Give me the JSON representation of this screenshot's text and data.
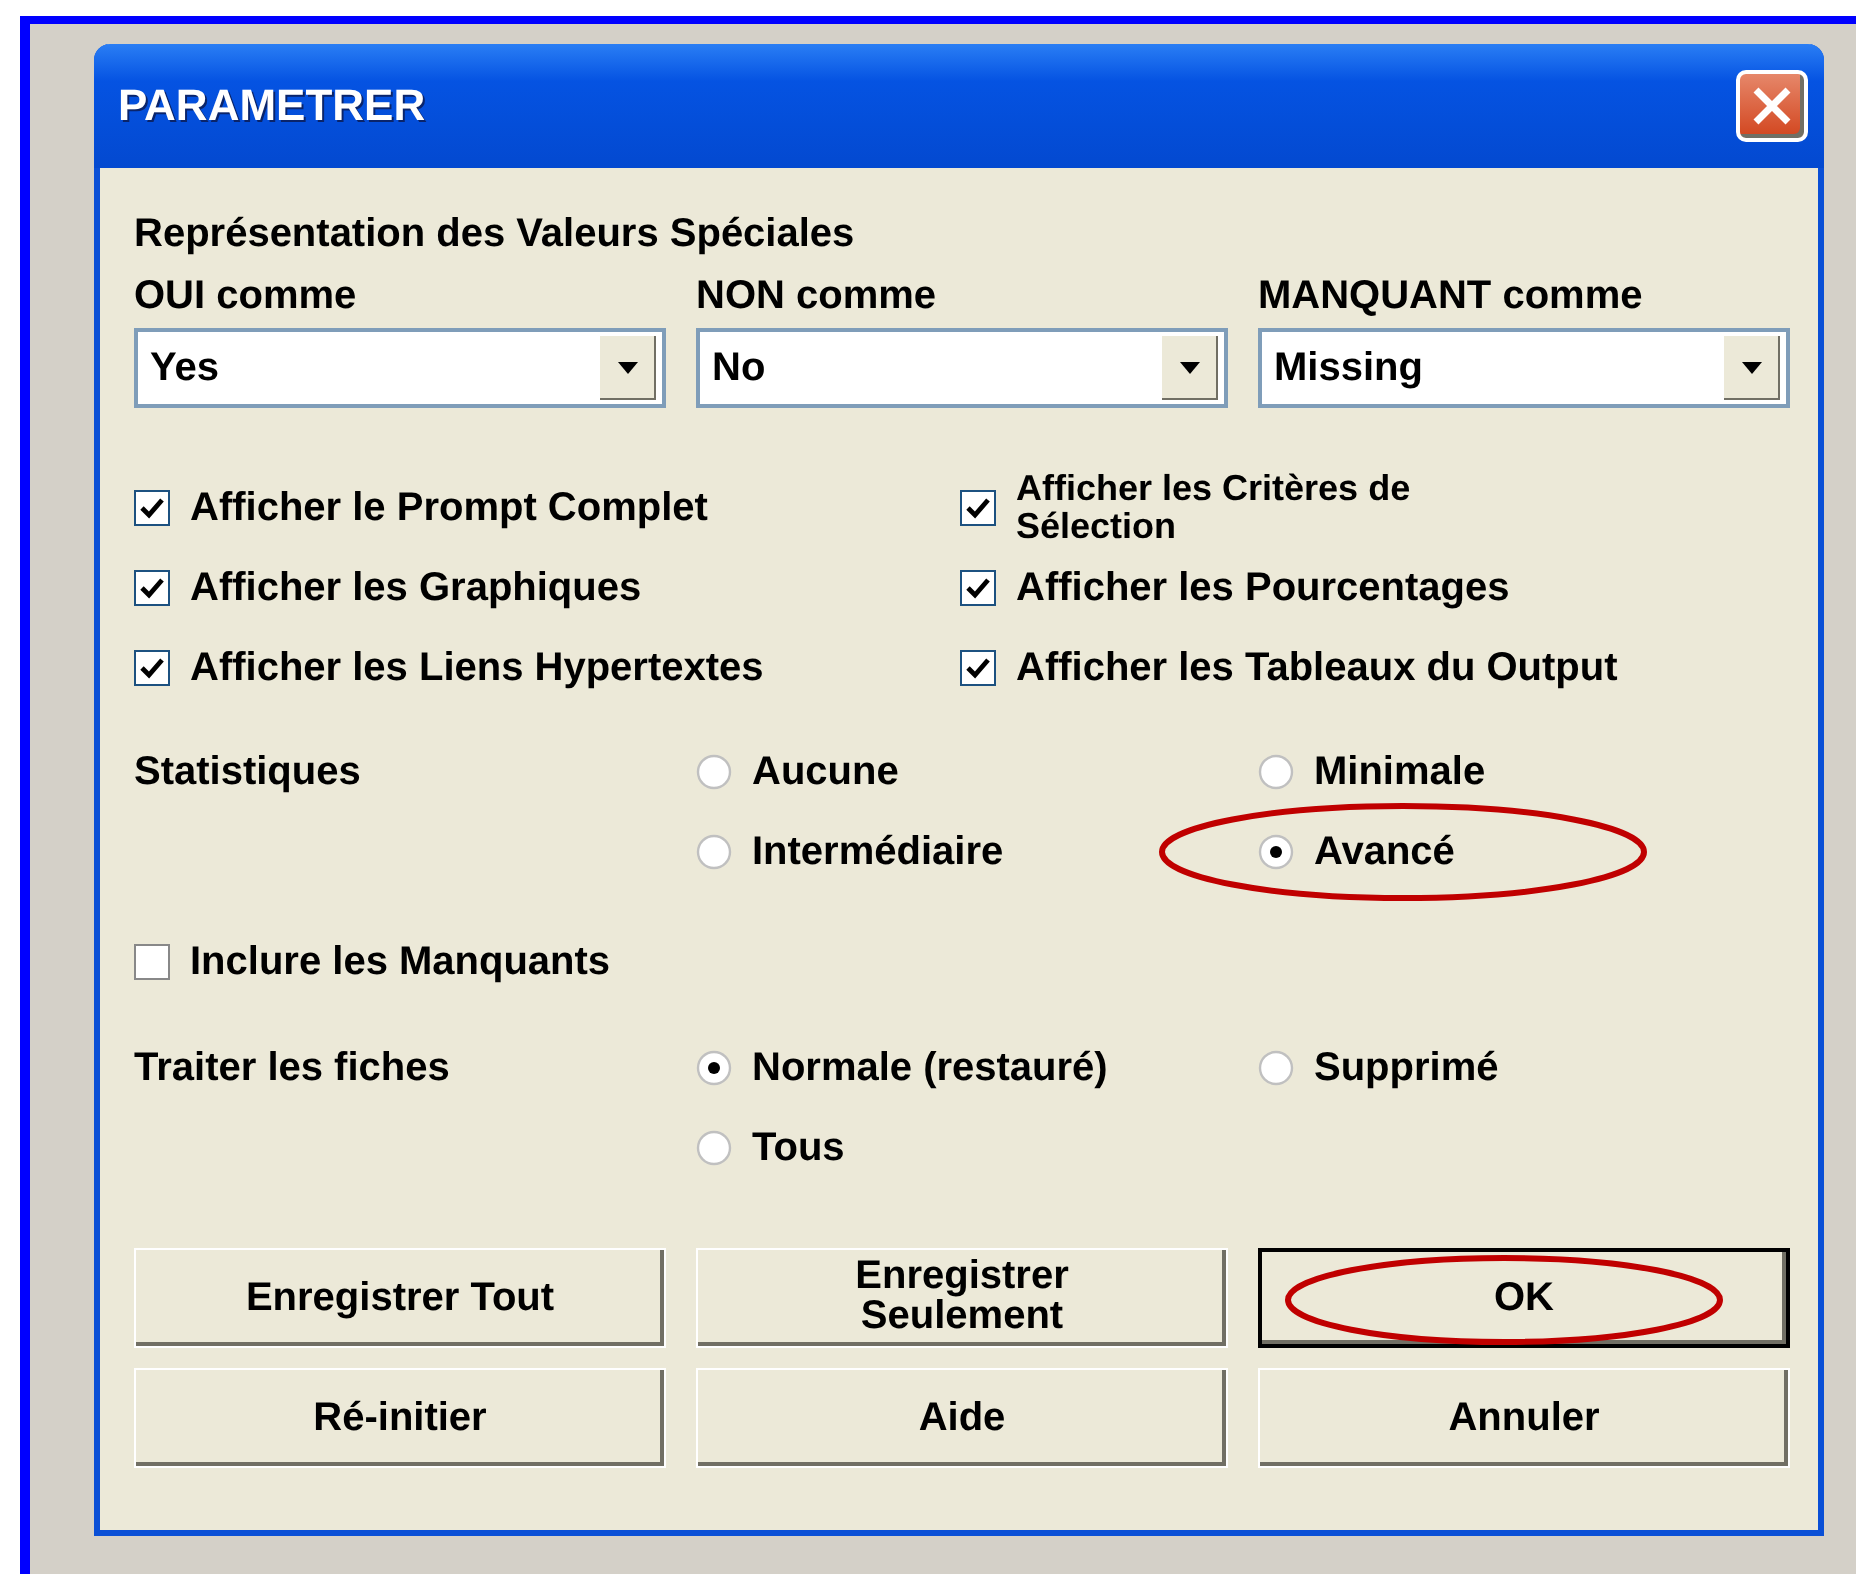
{
  "window": {
    "title": "PARAMETRER"
  },
  "section_title": "Représentation des Valeurs Spéciales",
  "dropdowns": [
    {
      "label": "OUI comme",
      "value": "Yes"
    },
    {
      "label": "NON comme",
      "value": "No"
    },
    {
      "label": "MANQUANT comme",
      "value": "Missing"
    }
  ],
  "checkboxes": [
    {
      "label": "Afficher le Prompt Complet",
      "checked": true
    },
    {
      "label": "Afficher les Critères de Sélection",
      "checked": true
    },
    {
      "label": "Afficher les Graphiques",
      "checked": true
    },
    {
      "label": "Afficher les Pourcentages",
      "checked": true
    },
    {
      "label": "Afficher les Liens Hypertextes",
      "checked": true
    },
    {
      "label": "Afficher les Tableaux du Output",
      "checked": true
    }
  ],
  "statistics": {
    "label": "Statistiques",
    "options": [
      {
        "label": "Aucune",
        "selected": false,
        "highlighted": false
      },
      {
        "label": "Minimale",
        "selected": false,
        "highlighted": false
      },
      {
        "label": "Intermédiaire",
        "selected": false,
        "highlighted": false
      },
      {
        "label": "Avancé",
        "selected": true,
        "highlighted": true
      }
    ]
  },
  "include_missing": {
    "label": "Inclure les Manquants",
    "checked": false
  },
  "records": {
    "label": "Traiter les fiches",
    "options": [
      {
        "label": "Normale (restauré)",
        "selected": true,
        "highlighted": false
      },
      {
        "label": "Supprimé",
        "selected": false,
        "highlighted": false
      },
      {
        "label": "Tous",
        "selected": false,
        "highlighted": false
      }
    ]
  },
  "buttons": [
    {
      "label": "Enregistrer Tout",
      "default": false,
      "highlighted": false
    },
    {
      "label": "Enregistrer Seulement",
      "default": false,
      "highlighted": false
    },
    {
      "label": "OK",
      "default": true,
      "highlighted": true
    },
    {
      "label": "Ré-initier",
      "default": false,
      "highlighted": false
    },
    {
      "label": "Aide",
      "default": false,
      "highlighted": false
    },
    {
      "label": "Annuler",
      "default": false,
      "highlighted": false
    }
  ]
}
